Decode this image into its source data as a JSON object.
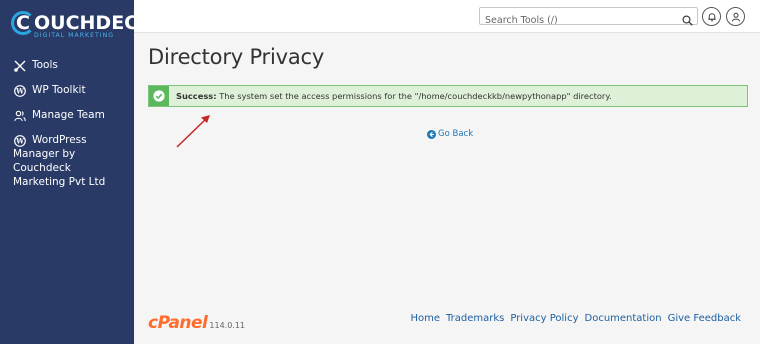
{
  "brand": {
    "name": "OUCHDECK",
    "initial": "C",
    "tagline": "DIGITAL MARKETING"
  },
  "sidebar": {
    "items": [
      {
        "label": "Tools",
        "icon": "tools-icon"
      },
      {
        "label": "WP Toolkit",
        "icon": "wordpress-icon"
      },
      {
        "label": "Manage Team",
        "icon": "team-icon"
      },
      {
        "label": "WordPress Manager by Couchdeck Marketing Pvt Ltd",
        "label_line1": "WordPress",
        "label_rest": "Manager by Couchdeck Marketing Pvt Ltd",
        "icon": "wordpress-icon"
      }
    ]
  },
  "header": {
    "search_placeholder": "Search Tools (/)"
  },
  "main": {
    "title": "Directory Privacy",
    "alert": {
      "label": "Success:",
      "message": "The system set the access permissions for the \"/home/couchdeckkb/newpythonapp\" directory."
    },
    "go_back": "Go Back"
  },
  "footer": {
    "product": "cPanel",
    "version": "114.0.11",
    "links": [
      "Home",
      "Trademarks",
      "Privacy Policy",
      "Documentation",
      "Give Feedback"
    ]
  },
  "colors": {
    "sidebar_bg": "#293a66",
    "success_bg": "#dff0d8",
    "success_border": "#7fc47b",
    "link": "#1f77b5",
    "cpanel_orange": "#ff6c2c",
    "annotation_arrow": "#c62828"
  }
}
